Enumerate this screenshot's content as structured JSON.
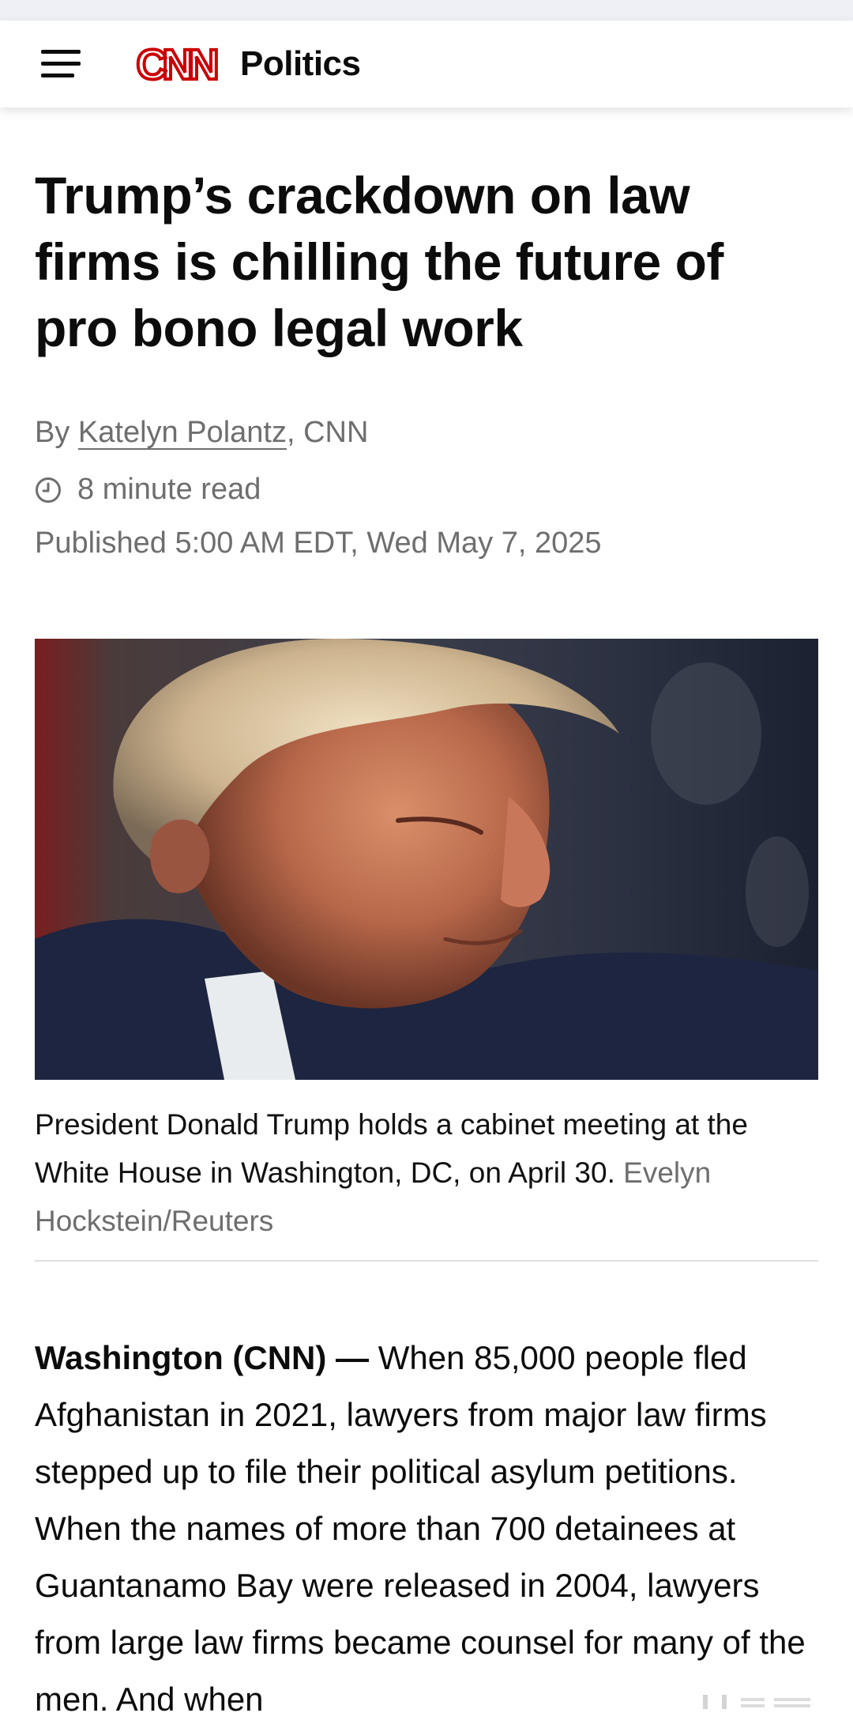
{
  "header": {
    "logo_text": "CNN",
    "section": "Politics"
  },
  "article": {
    "headline": "Trump’s crackdown on law firms is chilling the future of pro bono legal work",
    "byline_prefix": "By ",
    "author": "Katelyn Polantz",
    "byline_suffix": ", CNN",
    "read_time": "8 minute read",
    "published": "Published 5:00 AM EDT, Wed May 7, 2025",
    "image_caption": "President Donald Trump holds a cabinet meeting at the White House in Washington, DC, on April 30. ",
    "image_credit": "Evelyn Hockstein/Reuters",
    "dateline": "Washington (CNN) —",
    "body_first_paragraph": " When 85,000 people fled Afghanistan in 2021, lawyers from major law firms stepped up to file their political asylum petitions. When the names of more than 700 detainees at Guantanamo Bay were released in 2004, lawyers from large law firms became counsel for many of the men. And when"
  },
  "colors": {
    "brand_red": "#cc0000",
    "text_primary": "#0c0c0c",
    "text_muted": "#6e6e6e"
  },
  "icons": {
    "menu": "hamburger-menu-icon",
    "clock": "clock-icon"
  }
}
